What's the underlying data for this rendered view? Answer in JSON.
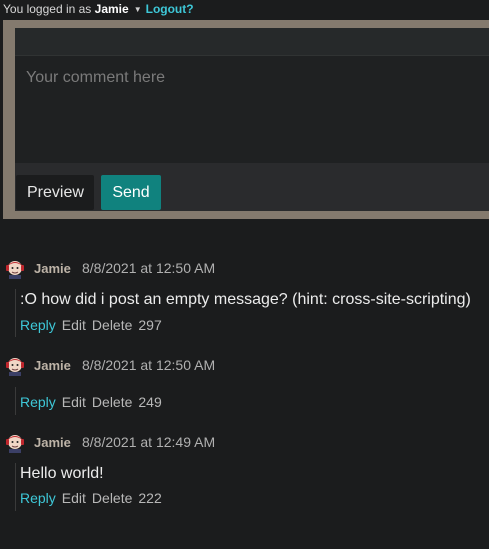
{
  "login": {
    "prefix": "You logged in as",
    "username": "Jamie",
    "logout_label": "Logout?"
  },
  "editor": {
    "placeholder": "Your comment here",
    "preview_label": "Preview",
    "send_label": "Send"
  },
  "comments": [
    {
      "author": "Jamie",
      "date": "8/8/2021 at 12:50 AM",
      "text": ":O how did i post an empty message? (hint: cross-site-scripting)",
      "reply": "Reply",
      "edit": "Edit",
      "delete": "Delete",
      "votes": "297"
    },
    {
      "author": "Jamie",
      "date": "8/8/2021 at 12:50 AM",
      "text": "",
      "reply": "Reply",
      "edit": "Edit",
      "delete": "Delete",
      "votes": "249"
    },
    {
      "author": "Jamie",
      "date": "8/8/2021 at 12:49 AM",
      "text": "Hello world!",
      "reply": "Reply",
      "edit": "Edit",
      "delete": "Delete",
      "votes": "222"
    }
  ],
  "icons": {
    "avatar": "user-avatar-icon",
    "dropdown": "caret-down-icon"
  },
  "colors": {
    "accent": "#3ec8d8",
    "send_button": "#10827e",
    "editor_frame": "#847a6e"
  }
}
